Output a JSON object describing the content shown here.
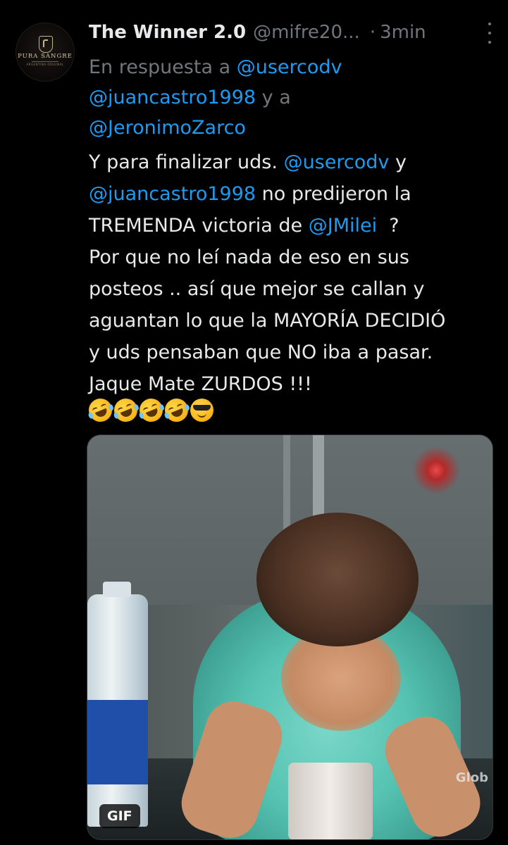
{
  "tweet": {
    "author": {
      "display_name": "The Winner 2.0",
      "handle": "@mifre20...",
      "separator": "·",
      "time": "3min",
      "avatar": {
        "brand_text": "PURA SANGRE",
        "sub_text": "ARGENTINA ORIGINAL"
      }
    },
    "reply_to": {
      "prefix": "En respuesta a",
      "mention_1": "@usercodv",
      "mention_2": "@juancastro1998",
      "connector": "y a",
      "mention_3": "@JeronimoZarco"
    },
    "body": {
      "l1_text": "Y para finalizar uds.",
      "l1_mention": "@usercodv",
      "l1_tail": "y",
      "l2_mention": "@juancastro1998",
      "l2_tail": "no predijeron la",
      "l3_head": "TREMENDA victoria de",
      "l3_mention": "@JMilei",
      "l3_tail": "?",
      "l4": "Por que no leí nada de eso en sus",
      "l5": "posteos .. así que mejor se callan y",
      "l6": "aguantan lo que la MAYORÍA DECIDIÓ",
      "l7": "y uds pensaban que NO iba a pasar.",
      "l8": "Jaque Mate  ZURDOS !!!",
      "emojis": [
        "rolling-on-floor-laughing",
        "rolling-on-floor-laughing",
        "rolling-on-floor-laughing",
        "rolling-on-floor-laughing",
        "smiling-face-with-sunglasses"
      ]
    },
    "media": {
      "type_badge": "GIF",
      "watermark": "Glob"
    }
  },
  "colors": {
    "background": "#000000",
    "text": "#e7e9ea",
    "secondary": "#71767b",
    "link": "#1d9bf0"
  }
}
